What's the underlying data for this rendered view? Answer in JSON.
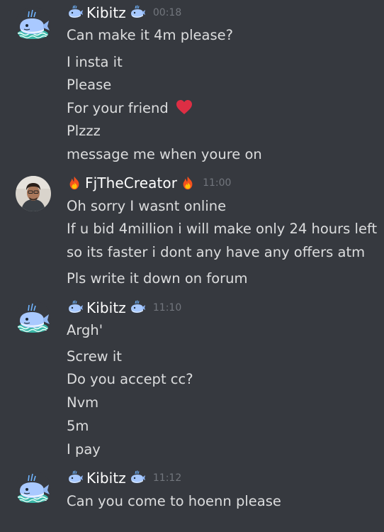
{
  "groups": [
    {
      "author": "Kibitz",
      "time": "00:18",
      "messages": [
        "Can make it 4m please?",
        "I insta it",
        "Please",
        "For your friend",
        "Plzzz",
        "message me when youre on"
      ]
    },
    {
      "author": "FjTheCreator",
      "time": "11:00",
      "messages": [
        "Oh sorry I wasnt online",
        "If u bid 4million i will make only 24 hours left",
        "so its faster i dont any have any offers atm",
        "Pls write it down on forum"
      ]
    },
    {
      "author": "Kibitz",
      "time": "11:10",
      "messages": [
        "Argh'",
        "Screw it",
        "Do you accept cc?",
        "Nvm",
        "5m",
        "I pay"
      ]
    },
    {
      "author": "Kibitz",
      "time": "11:12",
      "messages": [
        "Can you come to hoenn please"
      ]
    }
  ],
  "icons": {
    "kibitz_avatar": "whale-avatar-icon",
    "fj_avatar": "user-photo-avatar",
    "name_decoration_kibitz": "whale-emoji-icon",
    "name_decoration_fj": "fire-emoji-icon",
    "heart": "red-heart-emoji-icon"
  },
  "colors": {
    "background": "#36393f",
    "message_text": "#dcddde",
    "username": "#ffffff",
    "timestamp": "#72767d",
    "heart": "#dd2e44"
  }
}
